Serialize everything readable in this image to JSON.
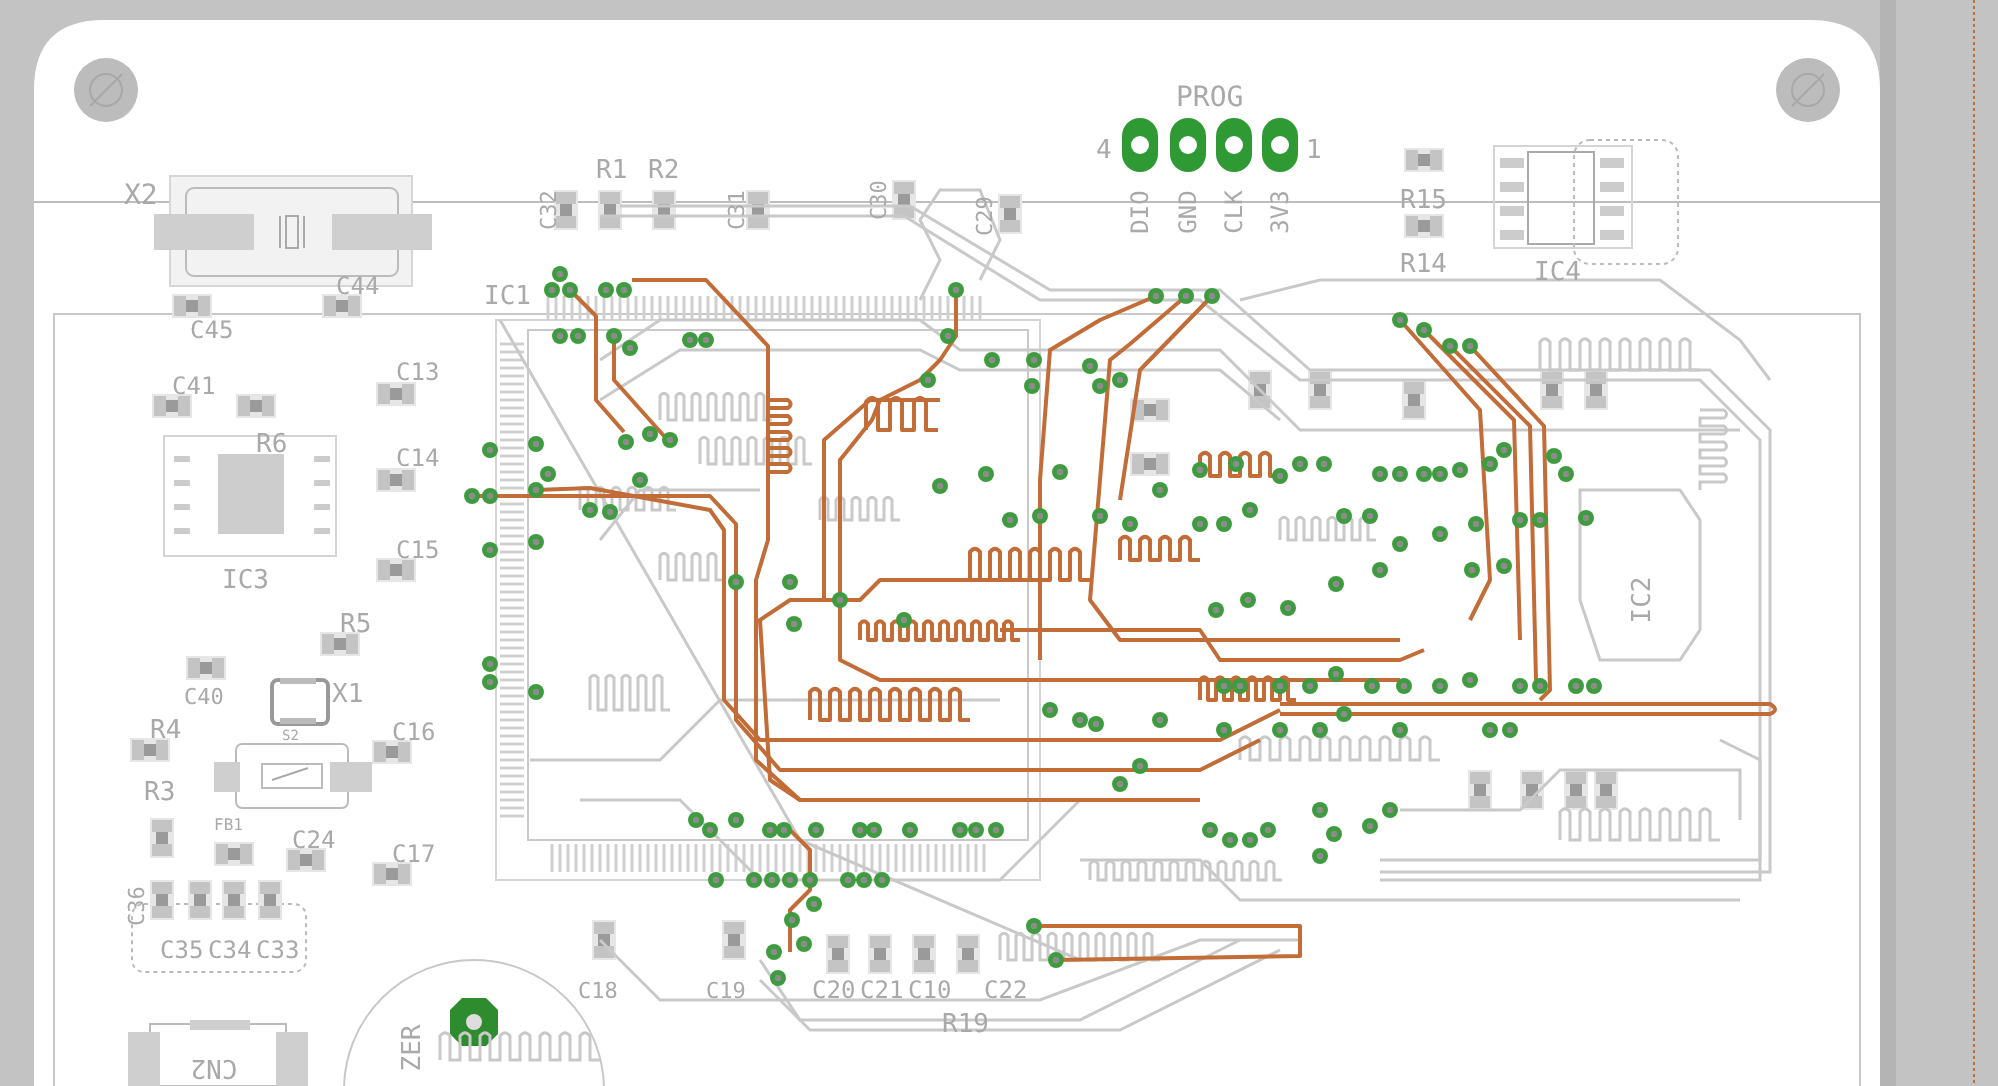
{
  "board": {
    "labels": [
      {
        "text": "X2"
      },
      {
        "text": "R1"
      },
      {
        "text": "R2"
      },
      {
        "text": "C32"
      },
      {
        "text": "C31"
      },
      {
        "text": "C30"
      },
      {
        "text": "C29"
      },
      {
        "text": "IC1"
      },
      {
        "text": "C44"
      },
      {
        "text": "C45"
      },
      {
        "text": "C41"
      },
      {
        "text": "R6"
      },
      {
        "text": "C13"
      },
      {
        "text": "C14"
      },
      {
        "text": "C15"
      },
      {
        "text": "IC3"
      },
      {
        "text": "R5"
      },
      {
        "text": "C40"
      },
      {
        "text": "X1"
      },
      {
        "text": "R4"
      },
      {
        "text": "C16"
      },
      {
        "text": "R3"
      },
      {
        "text": "FB1"
      },
      {
        "text": "C24"
      },
      {
        "text": "C17"
      },
      {
        "text": "C36"
      },
      {
        "text": "C35"
      },
      {
        "text": "C34"
      },
      {
        "text": "C33"
      },
      {
        "text": "C18"
      },
      {
        "text": "C19"
      },
      {
        "text": "C20"
      },
      {
        "text": "C21"
      },
      {
        "text": "C10"
      },
      {
        "text": "C22"
      },
      {
        "text": "R19"
      },
      {
        "text": "CN2"
      },
      {
        "text": "ZER"
      },
      {
        "text": "S2"
      },
      {
        "text": "R15"
      },
      {
        "text": "R14"
      },
      {
        "text": "IC4"
      },
      {
        "text": "IC2"
      }
    ],
    "header": {
      "title": "PROG",
      "pin_first": "4",
      "pin_last": "1",
      "pins": [
        "DIO",
        "GND",
        "CLK",
        "3V3"
      ]
    }
  }
}
